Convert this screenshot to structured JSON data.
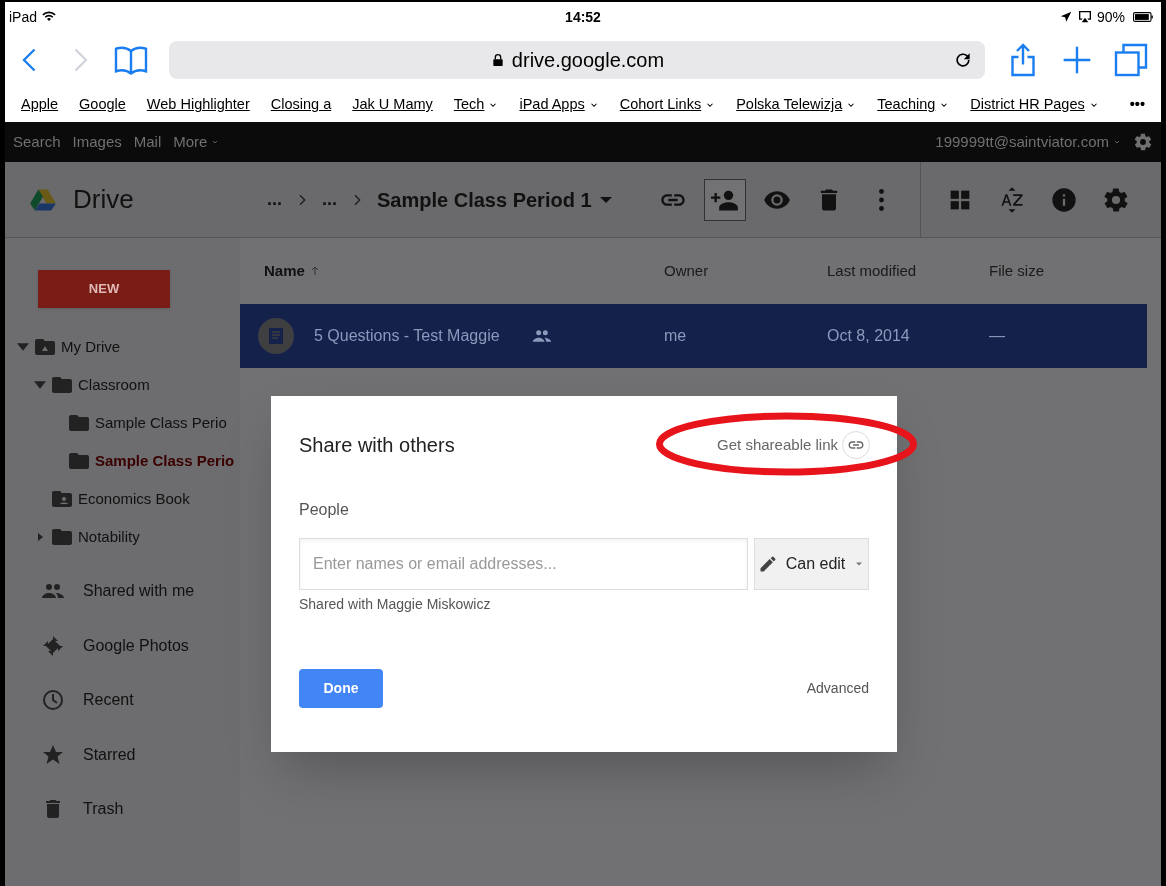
{
  "status_bar": {
    "device": "iPad",
    "time": "14:52",
    "battery": "90%"
  },
  "browser": {
    "url": "drive.google.com",
    "back_disabled": false,
    "forward_disabled": true,
    "bookmarks": [
      {
        "label": "Apple",
        "has_menu": false
      },
      {
        "label": "Google",
        "has_menu": false
      },
      {
        "label": "Web Highlighter",
        "has_menu": false
      },
      {
        "label": "Closing a",
        "has_menu": false
      },
      {
        "label": "Jak U Mamy",
        "has_menu": false
      },
      {
        "label": "Tech",
        "has_menu": true
      },
      {
        "label": "iPad Apps",
        "has_menu": true
      },
      {
        "label": "Cohort Links",
        "has_menu": true
      },
      {
        "label": "Polska Telewizja",
        "has_menu": true
      },
      {
        "label": "Teaching",
        "has_menu": true
      },
      {
        "label": "District HR Pages",
        "has_menu": true
      }
    ],
    "more": "•••"
  },
  "google_bar": {
    "links": [
      "Search",
      "Images",
      "Mail",
      "More"
    ],
    "account": "199999tt@saintviator.com"
  },
  "drive": {
    "app_name": "Drive",
    "breadcrumb": [
      "...",
      "..."
    ],
    "folder": "Sample Class Period 1",
    "toolbar": [
      {
        "kind": "link",
        "selected": false
      },
      {
        "kind": "add-person",
        "selected": true
      },
      {
        "kind": "preview",
        "selected": false
      },
      {
        "kind": "trash",
        "selected": false
      },
      {
        "kind": "more",
        "selected": false
      },
      {
        "kind": "grid",
        "selected": false
      },
      {
        "kind": "sort",
        "selected": false
      },
      {
        "kind": "info",
        "selected": false
      },
      {
        "kind": "settings",
        "selected": false
      }
    ],
    "new_button": "NEW",
    "tree": [
      {
        "label": "My Drive",
        "kind": "drive",
        "expanded": true,
        "selected": false,
        "children": [
          {
            "label": "Classroom",
            "kind": "folder",
            "expanded": true,
            "selected": false,
            "children": [
              {
                "label": "Sample Class Perio",
                "kind": "folder",
                "selected": false
              },
              {
                "label": "Sample Class Perio",
                "kind": "folder",
                "selected": true
              }
            ]
          },
          {
            "label": "Economics Book",
            "kind": "shared-folder",
            "selected": false
          },
          {
            "label": "Notability",
            "kind": "folder",
            "expanded": false,
            "selected": false
          }
        ]
      }
    ],
    "nav": [
      {
        "label": "Shared with me",
        "kind": "shared"
      },
      {
        "label": "Google Photos",
        "kind": "photos"
      },
      {
        "label": "Recent",
        "kind": "recent"
      },
      {
        "label": "Starred",
        "kind": "starred"
      },
      {
        "label": "Trash",
        "kind": "trash"
      }
    ],
    "table": {
      "columns": [
        {
          "label": "Name",
          "sorted": true
        },
        {
          "label": "Owner",
          "sorted": false
        },
        {
          "label": "Last modified",
          "sorted": false
        },
        {
          "label": "File size",
          "sorted": false
        }
      ],
      "rows": [
        {
          "name": "5 Questions - Test Maggie",
          "shared": true,
          "owner": "me",
          "modified": "Oct 8, 2014",
          "size": "—",
          "selected": true
        }
      ]
    }
  },
  "dialog": {
    "title": "Share with others",
    "link_label": "Get shareable link",
    "people_label": "People",
    "placeholder": "Enter names or email addresses...",
    "permission": "Can edit",
    "shared_with": "Shared with Maggie Miskowicz",
    "done": "Done",
    "advanced": "Advanced",
    "highlighted_link": true
  }
}
